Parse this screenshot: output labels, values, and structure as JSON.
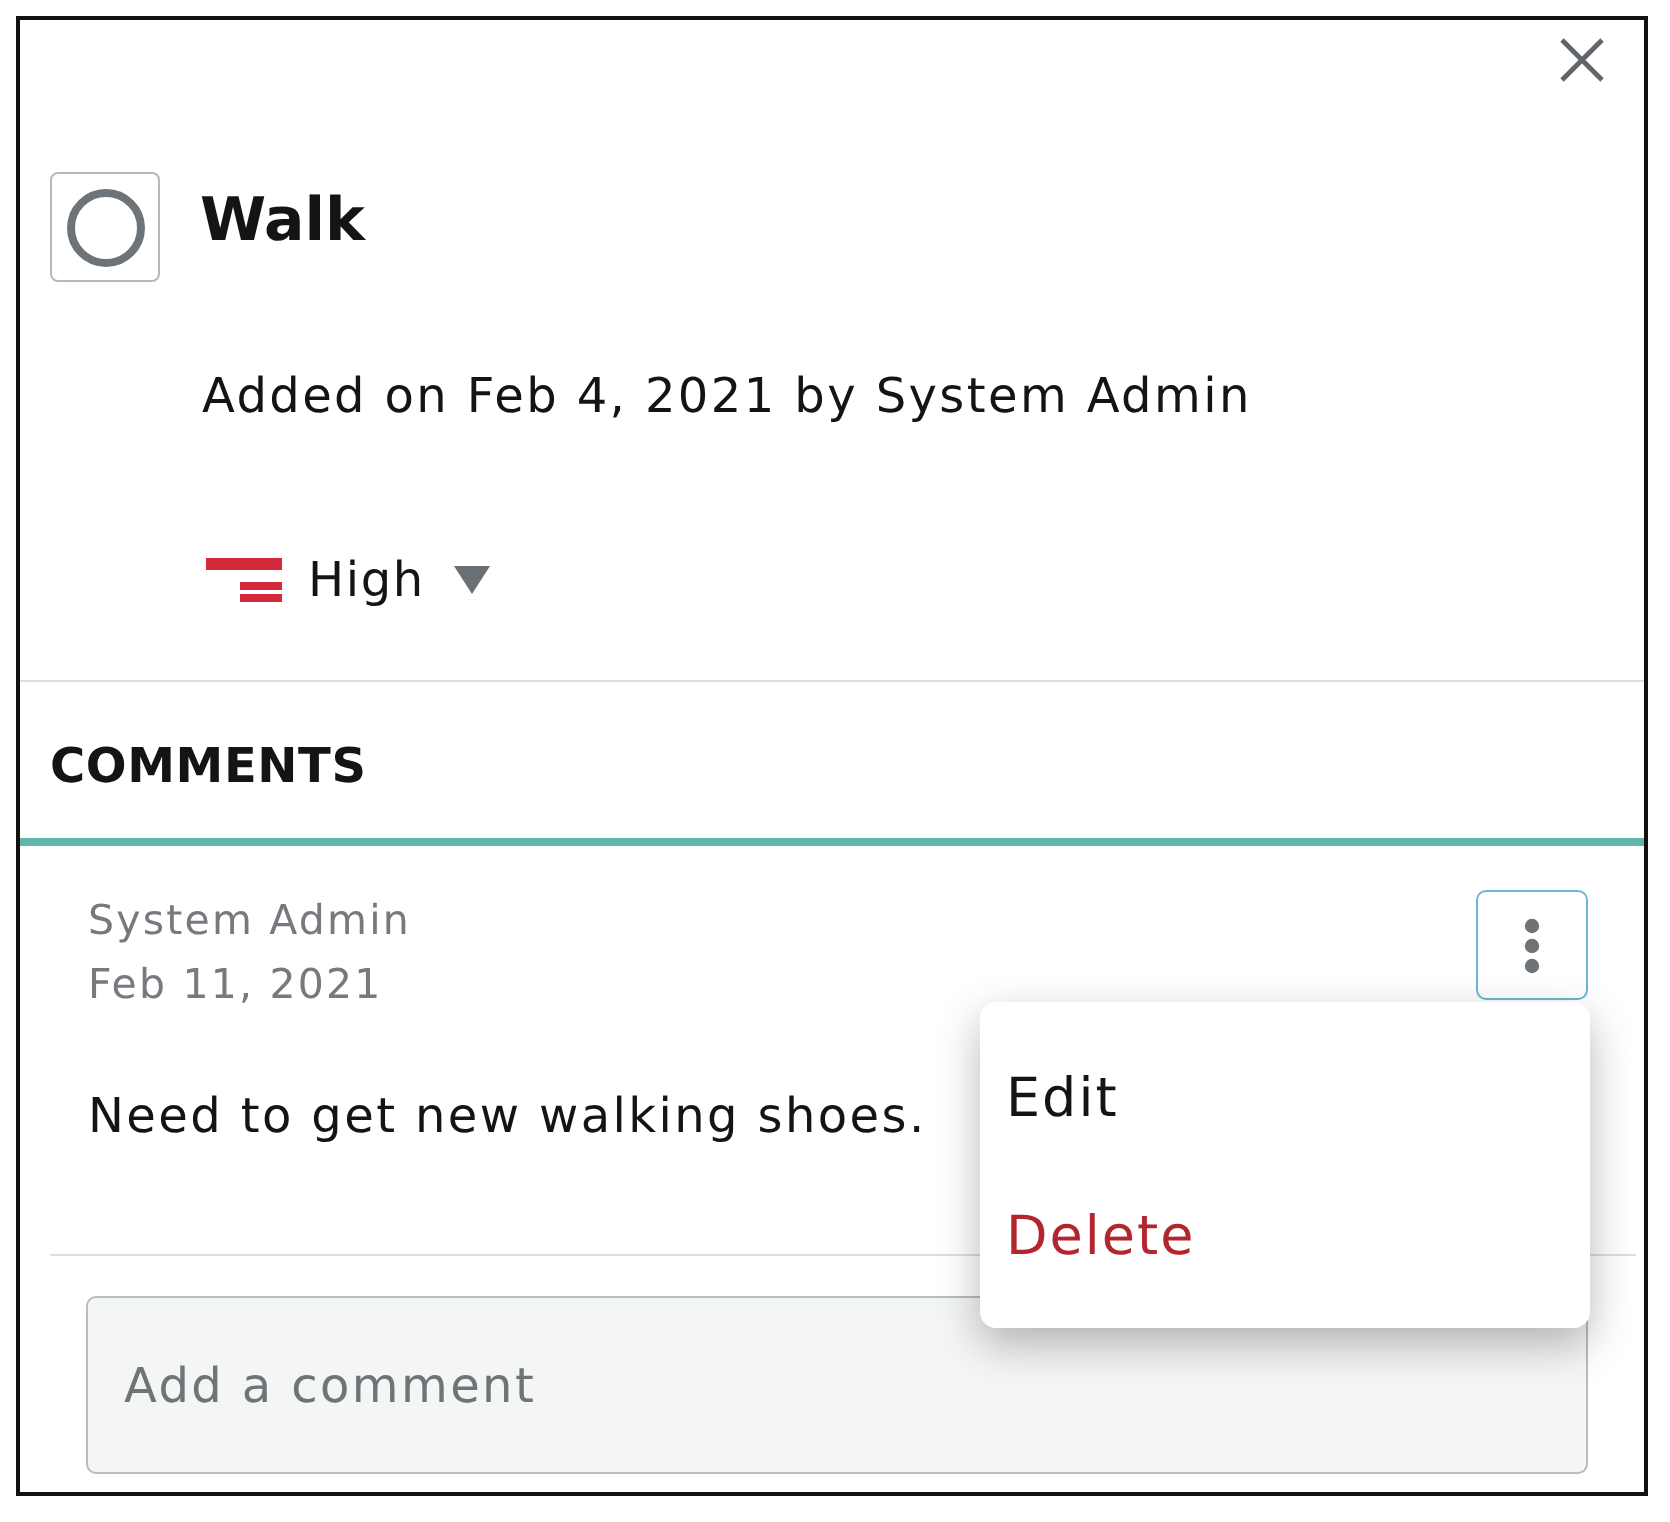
{
  "task": {
    "completed": false,
    "title": "Walk",
    "added_text": "Added on Feb 4, 2021 by System Admin",
    "priority": {
      "kind": "high",
      "label": "High"
    }
  },
  "comments": {
    "heading": "COMMENTS",
    "items": [
      {
        "author": "System Admin",
        "date": "Feb 11, 2021",
        "text": "Need to get new walking shoes.",
        "menu_open": true,
        "menu": [
          {
            "label": "Edit",
            "kind": "normal"
          },
          {
            "label": "Delete",
            "kind": "danger"
          }
        ]
      }
    ]
  },
  "comment_field": {
    "placeholder": "Add a comment"
  }
}
